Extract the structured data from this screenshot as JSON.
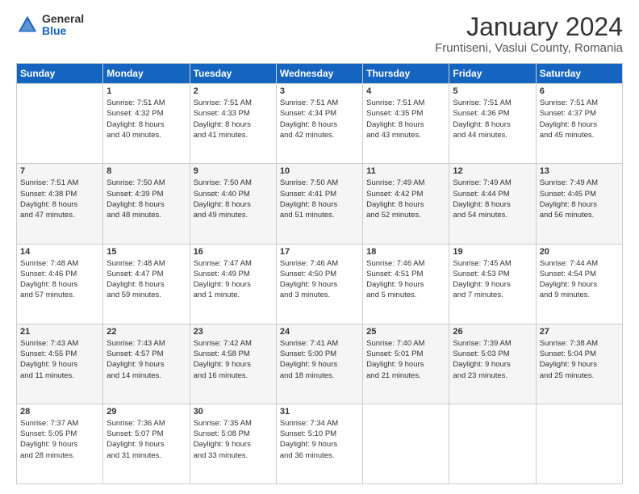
{
  "header": {
    "logo_general": "General",
    "logo_blue": "Blue",
    "title": "January 2024",
    "subtitle": "Fruntiseni, Vaslui County, Romania"
  },
  "weekdays": [
    "Sunday",
    "Monday",
    "Tuesday",
    "Wednesday",
    "Thursday",
    "Friday",
    "Saturday"
  ],
  "weeks": [
    [
      {
        "day": "",
        "info": ""
      },
      {
        "day": "1",
        "info": "Sunrise: 7:51 AM\nSunset: 4:32 PM\nDaylight: 8 hours\nand 40 minutes."
      },
      {
        "day": "2",
        "info": "Sunrise: 7:51 AM\nSunset: 4:33 PM\nDaylight: 8 hours\nand 41 minutes."
      },
      {
        "day": "3",
        "info": "Sunrise: 7:51 AM\nSunset: 4:34 PM\nDaylight: 8 hours\nand 42 minutes."
      },
      {
        "day": "4",
        "info": "Sunrise: 7:51 AM\nSunset: 4:35 PM\nDaylight: 8 hours\nand 43 minutes."
      },
      {
        "day": "5",
        "info": "Sunrise: 7:51 AM\nSunset: 4:36 PM\nDaylight: 8 hours\nand 44 minutes."
      },
      {
        "day": "6",
        "info": "Sunrise: 7:51 AM\nSunset: 4:37 PM\nDaylight: 8 hours\nand 45 minutes."
      }
    ],
    [
      {
        "day": "7",
        "info": "Sunrise: 7:51 AM\nSunset: 4:38 PM\nDaylight: 8 hours\nand 47 minutes."
      },
      {
        "day": "8",
        "info": "Sunrise: 7:50 AM\nSunset: 4:39 PM\nDaylight: 8 hours\nand 48 minutes."
      },
      {
        "day": "9",
        "info": "Sunrise: 7:50 AM\nSunset: 4:40 PM\nDaylight: 8 hours\nand 49 minutes."
      },
      {
        "day": "10",
        "info": "Sunrise: 7:50 AM\nSunset: 4:41 PM\nDaylight: 8 hours\nand 51 minutes."
      },
      {
        "day": "11",
        "info": "Sunrise: 7:49 AM\nSunset: 4:42 PM\nDaylight: 8 hours\nand 52 minutes."
      },
      {
        "day": "12",
        "info": "Sunrise: 7:49 AM\nSunset: 4:44 PM\nDaylight: 8 hours\nand 54 minutes."
      },
      {
        "day": "13",
        "info": "Sunrise: 7:49 AM\nSunset: 4:45 PM\nDaylight: 8 hours\nand 56 minutes."
      }
    ],
    [
      {
        "day": "14",
        "info": "Sunrise: 7:48 AM\nSunset: 4:46 PM\nDaylight: 8 hours\nand 57 minutes."
      },
      {
        "day": "15",
        "info": "Sunrise: 7:48 AM\nSunset: 4:47 PM\nDaylight: 8 hours\nand 59 minutes."
      },
      {
        "day": "16",
        "info": "Sunrise: 7:47 AM\nSunset: 4:49 PM\nDaylight: 9 hours\nand 1 minute."
      },
      {
        "day": "17",
        "info": "Sunrise: 7:46 AM\nSunset: 4:50 PM\nDaylight: 9 hours\nand 3 minutes."
      },
      {
        "day": "18",
        "info": "Sunrise: 7:46 AM\nSunset: 4:51 PM\nDaylight: 9 hours\nand 5 minutes."
      },
      {
        "day": "19",
        "info": "Sunrise: 7:45 AM\nSunset: 4:53 PM\nDaylight: 9 hours\nand 7 minutes."
      },
      {
        "day": "20",
        "info": "Sunrise: 7:44 AM\nSunset: 4:54 PM\nDaylight: 9 hours\nand 9 minutes."
      }
    ],
    [
      {
        "day": "21",
        "info": "Sunrise: 7:43 AM\nSunset: 4:55 PM\nDaylight: 9 hours\nand 11 minutes."
      },
      {
        "day": "22",
        "info": "Sunrise: 7:43 AM\nSunset: 4:57 PM\nDaylight: 9 hours\nand 14 minutes."
      },
      {
        "day": "23",
        "info": "Sunrise: 7:42 AM\nSunset: 4:58 PM\nDaylight: 9 hours\nand 16 minutes."
      },
      {
        "day": "24",
        "info": "Sunrise: 7:41 AM\nSunset: 5:00 PM\nDaylight: 9 hours\nand 18 minutes."
      },
      {
        "day": "25",
        "info": "Sunrise: 7:40 AM\nSunset: 5:01 PM\nDaylight: 9 hours\nand 21 minutes."
      },
      {
        "day": "26",
        "info": "Sunrise: 7:39 AM\nSunset: 5:03 PM\nDaylight: 9 hours\nand 23 minutes."
      },
      {
        "day": "27",
        "info": "Sunrise: 7:38 AM\nSunset: 5:04 PM\nDaylight: 9 hours\nand 25 minutes."
      }
    ],
    [
      {
        "day": "28",
        "info": "Sunrise: 7:37 AM\nSunset: 5:05 PM\nDaylight: 9 hours\nand 28 minutes."
      },
      {
        "day": "29",
        "info": "Sunrise: 7:36 AM\nSunset: 5:07 PM\nDaylight: 9 hours\nand 31 minutes."
      },
      {
        "day": "30",
        "info": "Sunrise: 7:35 AM\nSunset: 5:08 PM\nDaylight: 9 hours\nand 33 minutes."
      },
      {
        "day": "31",
        "info": "Sunrise: 7:34 AM\nSunset: 5:10 PM\nDaylight: 9 hours\nand 36 minutes."
      },
      {
        "day": "",
        "info": ""
      },
      {
        "day": "",
        "info": ""
      },
      {
        "day": "",
        "info": ""
      }
    ]
  ]
}
